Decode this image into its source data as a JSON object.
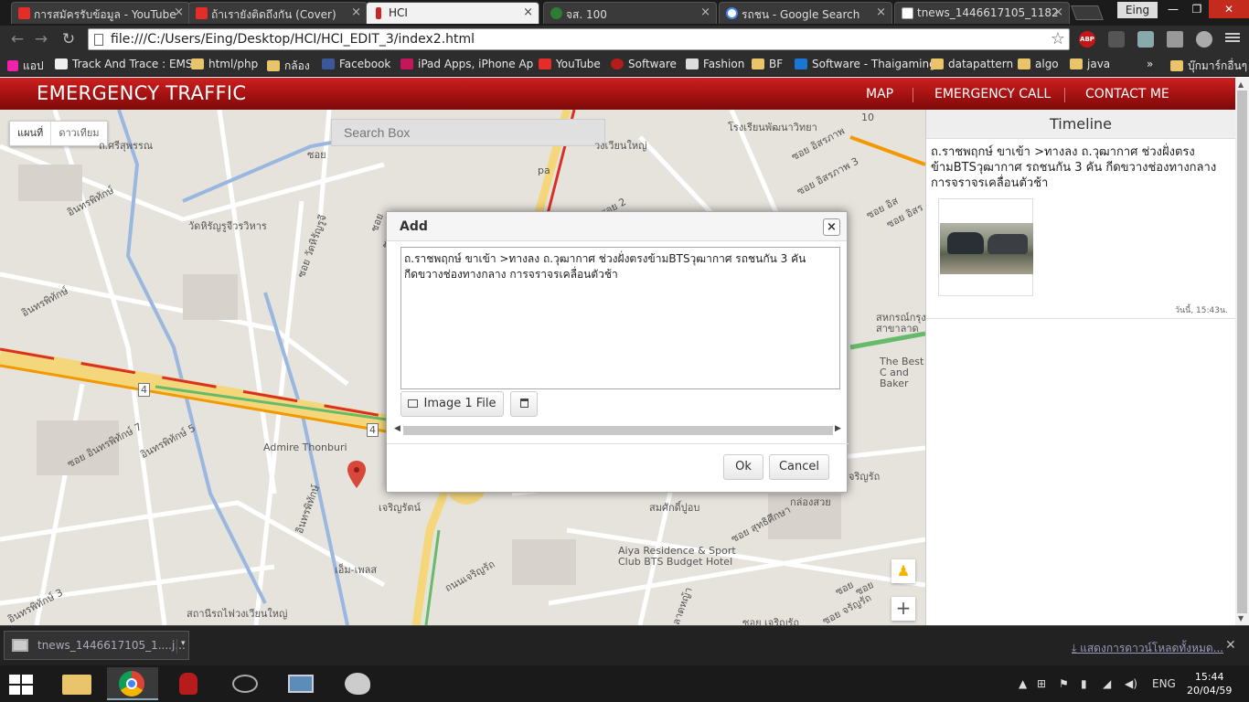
{
  "browser": {
    "tabs": [
      {
        "title": "การสมัครรับข้อมูล - YouTube",
        "icon": "youtube-icon",
        "color": "#e52d27"
      },
      {
        "title": "ถ้าเรายังติดถึงกัน (Cover)",
        "icon": "youtube-icon",
        "color": "#e52d27"
      },
      {
        "title": "HCI",
        "icon": "page-icon",
        "color": "#c62828"
      },
      {
        "title": "จส. 100",
        "icon": "site-icon",
        "color": "#2e7d32"
      },
      {
        "title": "รถชน - Google Search",
        "icon": "google-icon",
        "color": "#4285f4"
      },
      {
        "title": "tnews_1446617105_1182",
        "icon": "file-icon",
        "color": "#777777"
      }
    ],
    "user_label": "Eing",
    "url": "file:///C:/Users/Eing/Desktop/HCI/HCI_EDIT_3/index2.html",
    "extensions": {
      "abp": "ABP"
    },
    "bookmarks": [
      {
        "label": "แอป"
      },
      {
        "label": "Track And Trace : EMS"
      },
      {
        "label": "html/php"
      },
      {
        "label": "กล้อง"
      },
      {
        "label": "Facebook"
      },
      {
        "label": "iPad Apps, iPhone Ap"
      },
      {
        "label": "YouTube"
      },
      {
        "label": "Software"
      },
      {
        "label": "Fashion"
      },
      {
        "label": "BF"
      },
      {
        "label": "Software - Thaigaming"
      },
      {
        "label": "datapattern"
      },
      {
        "label": "algo"
      },
      {
        "label": "java"
      },
      {
        "label": "»"
      },
      {
        "label": "บุ๊กมาร์กอื่นๆ"
      }
    ]
  },
  "app": {
    "brand": "EMERGENCY TRAFFIC",
    "nav": [
      "MAP",
      "EMERGENCY CALL",
      "CONTACT ME"
    ],
    "accent": "#b71c1c"
  },
  "map": {
    "type_buttons": [
      "แผนที่",
      "ดาวเทียม"
    ],
    "search_placeholder": "Search Box",
    "labels": [
      "ถ.ศรีสุพรรณ",
      "อินทรพิทักษ์",
      "วัดหิรัญรูจีวรวิหาร",
      "ซอย วัดหิรัญรูจี",
      "อินทรพิทักษ์",
      "ซอย อินทรพิทักษ์ 7",
      "อินทรพิทักษ์ 5",
      "Admire Thonburi",
      "อินทรพิทักษ์",
      "เจริญรัตน์",
      "เอ็ม-เพลส",
      "ถนนเจริญรัถ",
      "สถานีรถไฟวงเวียนใหญ่",
      "อินทรพิทักษ์ 3",
      "ซอย",
      "วงเวียนใหญ่",
      "โรงเรียนพัฒนาวิทยา",
      "ซอย อิสรภาพ 3",
      "ซอย อิสรภาพ",
      "10",
      "สมศักดิ์ปูอบ",
      "กล่องสวย",
      "ซอย สุทธิศึกษา",
      "Aiya Residence & Sport Club BTS Budget Hotel",
      "ลาดหญ้า",
      "ซอย เจริญรัถ",
      "ซอย",
      "จริญรัถ",
      "สหกรณ์กรุง สาขาลาด",
      "The Best C and Baker",
      "ซอย อิสร",
      "pa",
      "ซอย 2",
      "ซอย",
      "ซอย อิส",
      "ซอย จรัญรัถ",
      "ชอย",
      "ชอย จ",
      "4",
      "4"
    ]
  },
  "timeline": {
    "title": "Timeline",
    "post_text": "ถ.ราชพฤกษ์ ขาเข้า >ทางลง ถ.วุฒากาศ ช่วงฝั่งตรงข้ามBTSวุฒากาศ รถชนกัน 3 คัน กีดขวางช่องทางกลาง การจราจรเคลื่อนตัวช้า",
    "timestamp": "วันนี้, 15:43น."
  },
  "modal": {
    "title": "Add",
    "close": "×",
    "text": "ถ.ราชพฤกษ์ ขาเข้า >ทางลง ถ.วุฒากาศ ช่วงฝั่งตรงข้ามBTSวุฒากาศ รถชนกัน 3 คัน กีดขวางช่องทางกลาง การจราจรเคลื่อนตัวช้า",
    "image_button": "Image 1 File",
    "ok": "Ok",
    "cancel": "Cancel"
  },
  "downloads": {
    "file": "tnews_1446617105_1....j...",
    "show_all": "แสดงการดาวน์โหลดทั้งหมด..."
  },
  "taskbar": {
    "lang": "ENG",
    "time": "15:44",
    "date": "20/04/59"
  }
}
